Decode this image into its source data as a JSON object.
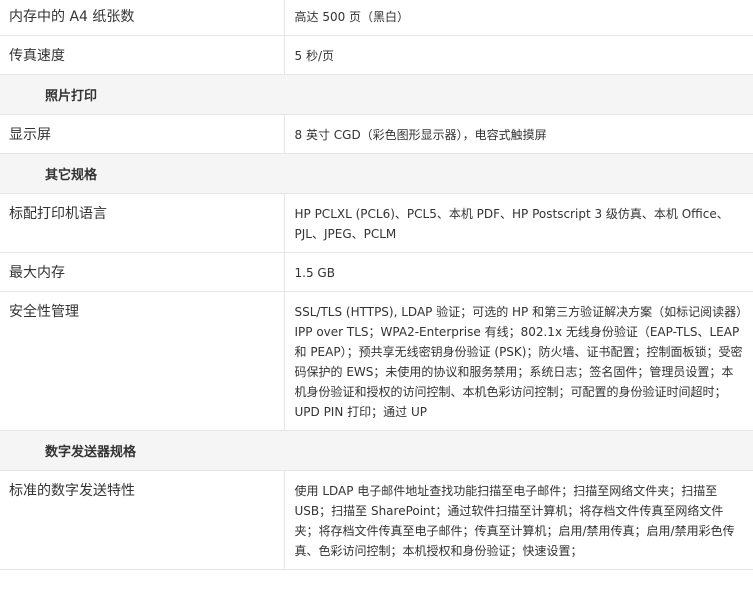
{
  "rows": [
    {
      "type": "row",
      "label": "内存中的 A4 纸张数",
      "value": "高达 500 页（黑白）"
    },
    {
      "type": "row",
      "label": "传真速度",
      "value": "5 秒/页"
    },
    {
      "type": "section",
      "title": "照片打印"
    },
    {
      "type": "row",
      "label": "显示屏",
      "value": "8 英寸 CGD（彩色图形显示器），电容式触摸屏"
    },
    {
      "type": "section",
      "title": "其它规格"
    },
    {
      "type": "row",
      "label": "标配打印机语言",
      "value": "HP PCLXL (PCL6)、PCL5、本机 PDF、HP Postscript 3 级仿真、本机 Office、PJL、JPEG、PCLM"
    },
    {
      "type": "row",
      "label": "最大内存",
      "value": "1.5 GB"
    },
    {
      "type": "row",
      "label": "安全性管理",
      "value": "SSL/TLS (HTTPS), LDAP 验证；可选的 HP 和第三方验证解决方案（如标记阅读器）IPP over TLS；WPA2-Enterprise 有线；802.1x 无线身份验证（EAP-TLS、LEAP 和 PEAP）；预共享无线密钥身份验证 (PSK)；防火墙、证书配置；控制面板锁；受密码保护的 EWS；未使用的协议和服务禁用；系统日志；签名固件；管理员设置；本机身份验证和授权的访问控制、本机色彩访问控制；可配置的身份验证时间超时；UPD PIN 打印；通过 UP"
    },
    {
      "type": "section",
      "title": "数字发送器规格"
    },
    {
      "type": "row",
      "label": "标准的数字发送特性",
      "value": "使用 LDAP 电子邮件地址查找功能扫描至电子邮件；扫描至网络文件夹；扫描至 USB；扫描至 SharePoint；通过软件扫描至计算机；将存档文件传真至网络文件夹；将存档文件传真至电子邮件；传真至计算机；启用/禁用传真；启用/禁用彩色传真、色彩访问控制；本机授权和身份验证；快速设置；"
    }
  ]
}
